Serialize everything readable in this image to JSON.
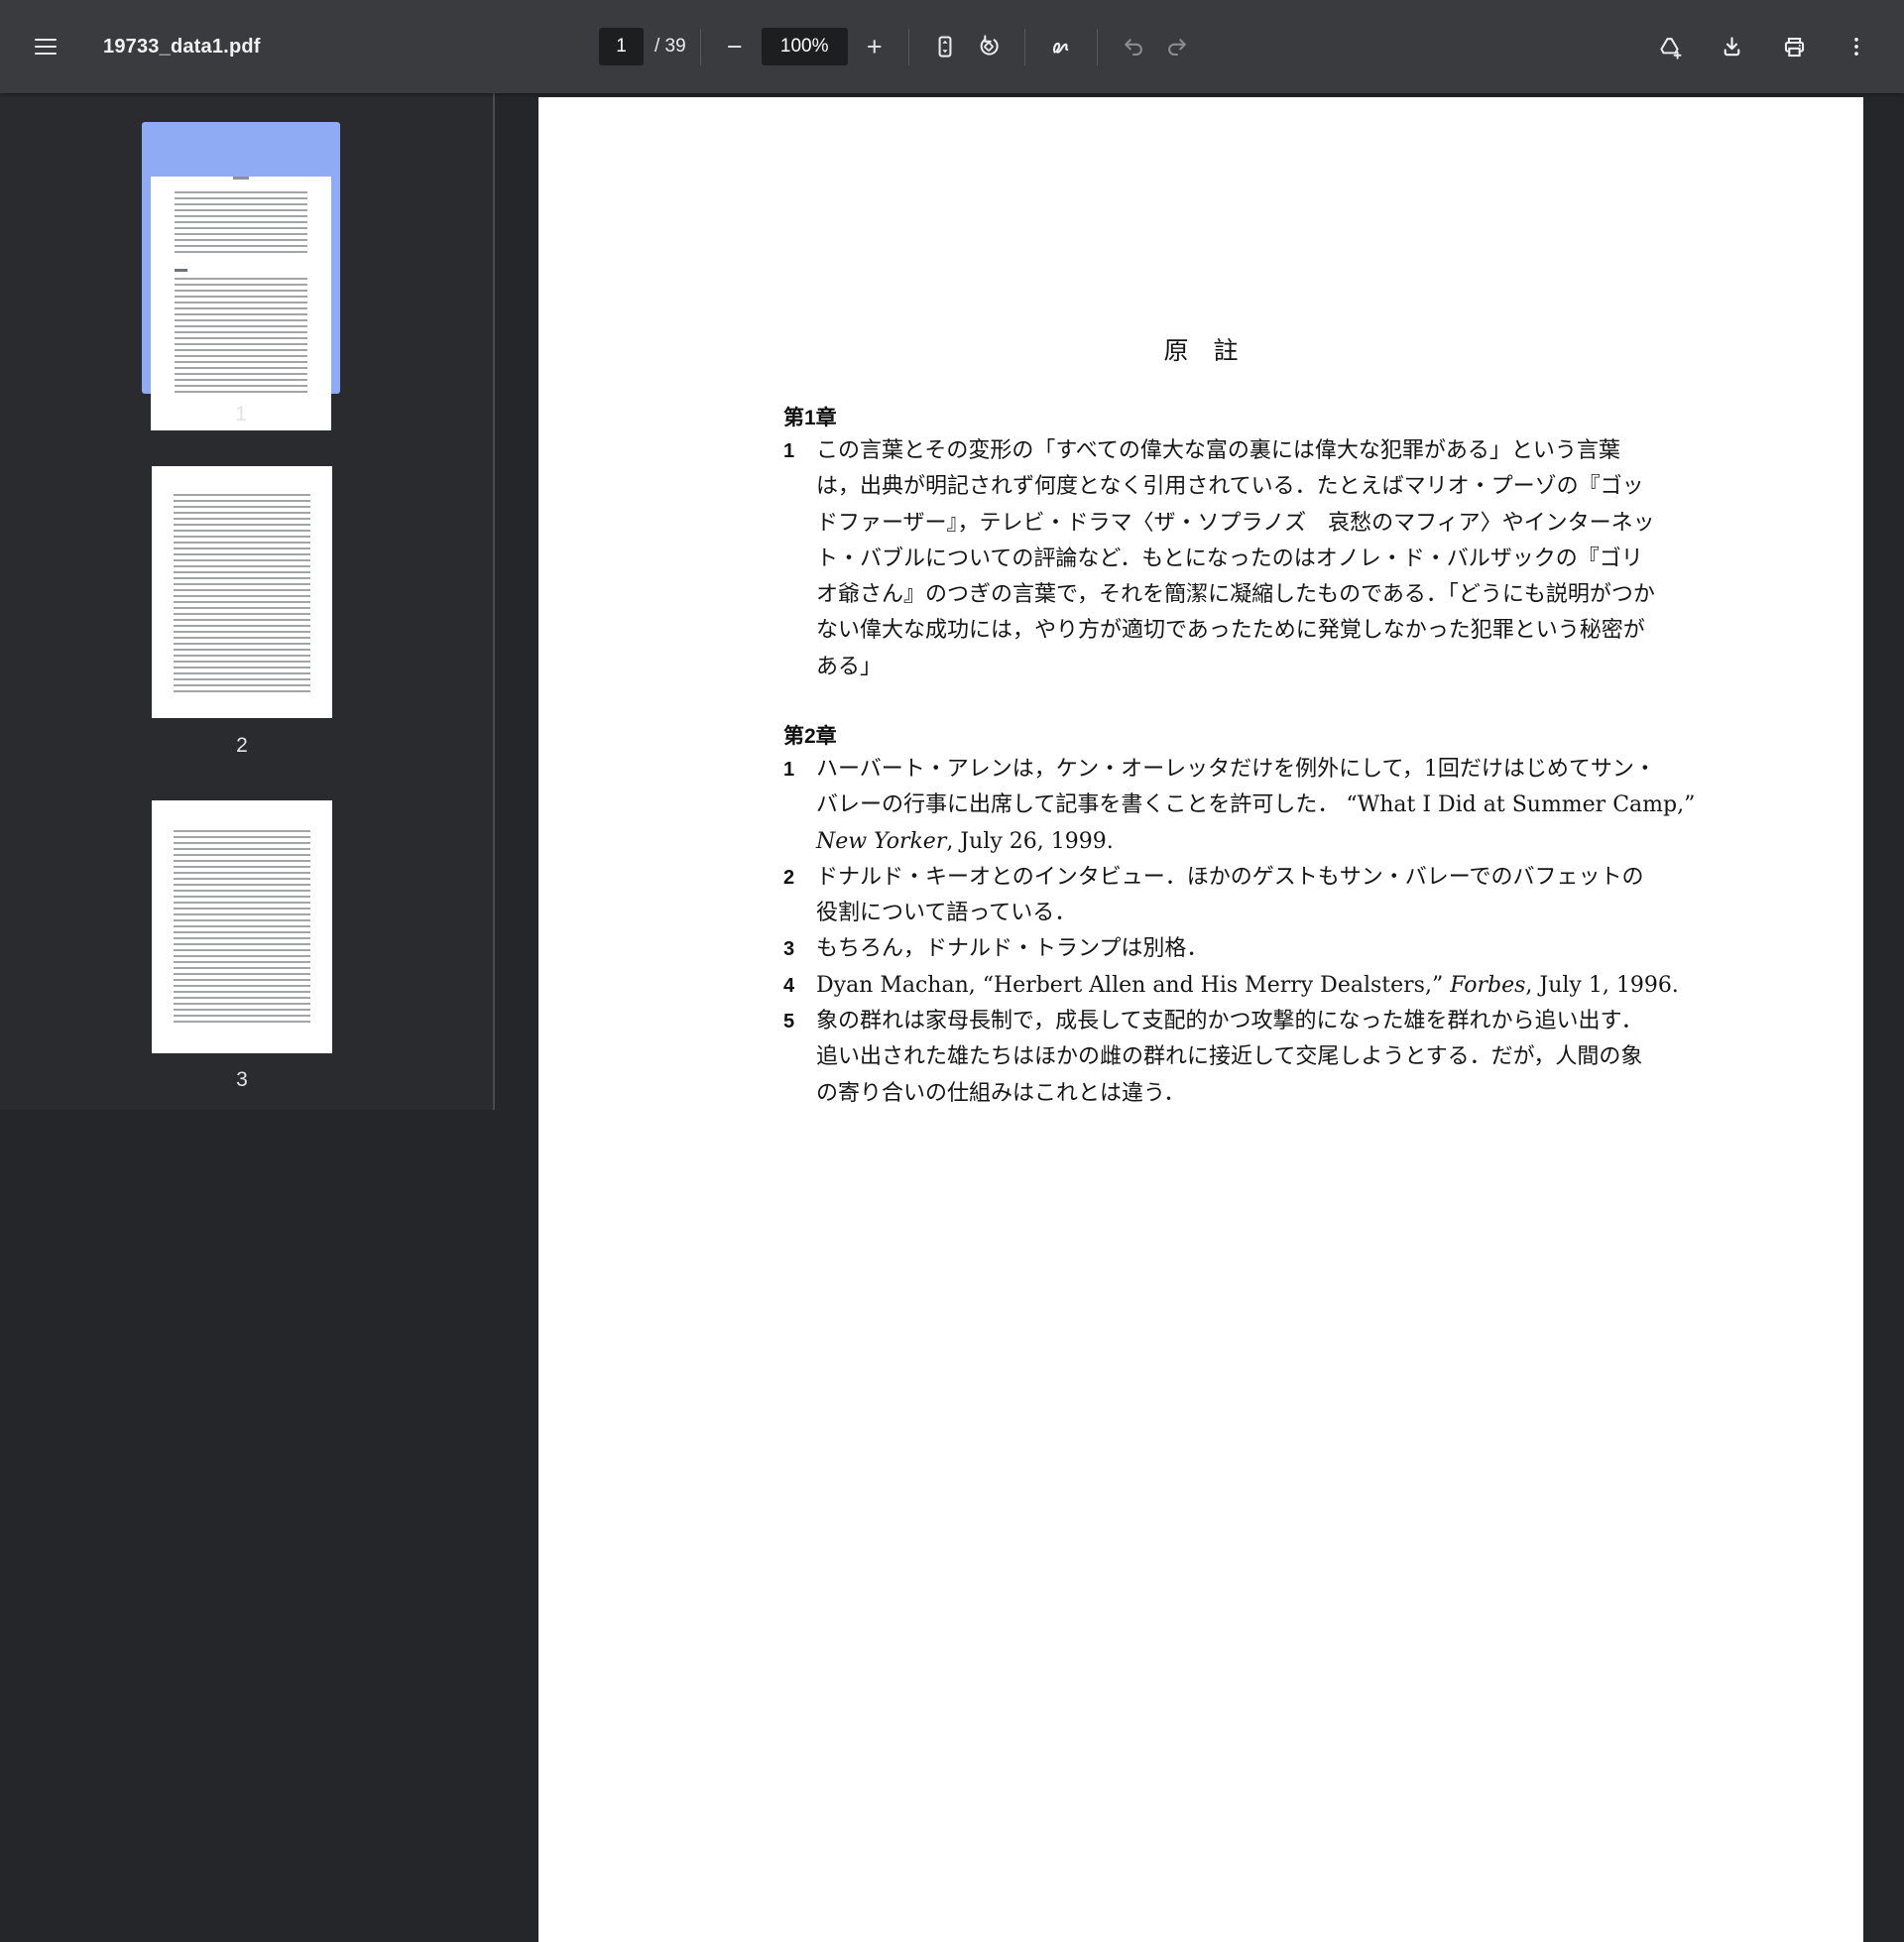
{
  "toolbar": {
    "filename": "19733_data1.pdf",
    "page_current": "1",
    "page_total": "/ 39",
    "zoom_out": "−",
    "zoom_level": "100%",
    "zoom_in": "+"
  },
  "icons": {
    "menu": "hamburger",
    "fit_page": "fit-to-page",
    "rotate": "rotate-counterclockwise",
    "annotate": "ink-pen-squiggle",
    "undo": "undo-arrow",
    "redo": "redo-arrow",
    "add_to_drive": "drive-add",
    "download": "download-arrow-tray",
    "print": "printer",
    "more": "vertical-three-dots"
  },
  "colors": {
    "toolbar_bg": "#3a3b3e",
    "sidebar_bg": "#2a2b2e",
    "viewer_bg": "#252629",
    "selected_thumbnail_border": "#8fabf3",
    "control_box_bg": "#1d1e20",
    "page_bg": "#ffffff"
  },
  "sidebar": {
    "thumbnails": [
      {
        "label": "1",
        "selected": true
      },
      {
        "label": "2",
        "selected": false
      },
      {
        "label": "3",
        "selected": false
      }
    ]
  },
  "doc": {
    "title": "原　註",
    "ch1": {
      "heading": "第1章",
      "n1": {
        "num": "1",
        "l1": "この言葉とその変形の「すべての偉大な富の裏には偉大な犯罪がある」という言葉",
        "l2": "は，出典が明記されず何度となく引用されている．たとえばマリオ・プーゾの『ゴッ",
        "l3": "ドファーザー』，テレビ・ドラマ〈ザ・ソプラノズ　哀愁のマフィア〉やインターネッ",
        "l4": "ト・バブルについての評論など．もとになったのはオノレ・ド・バルザックの『ゴリ",
        "l5": "オ爺さん』のつぎの言葉で，それを簡潔に凝縮したものである．「どうにも説明がつか",
        "l6": "ない偉大な成功には，やり方が適切であったために発覚しなかった犯罪という秘密が",
        "l7": "ある」"
      }
    },
    "ch2": {
      "heading": "第2章",
      "n1": {
        "num": "1",
        "l1": "ハーバート・アレンは，ケン・オーレッタだけを例外にして，1回だけはじめてサン・",
        "l2": "バレーの行事に出席して記事を書くことを許可した． “What I Did at Summer Camp,”",
        "l3_italic": "New Yorker",
        "l3_rest": ", July 26, 1999."
      },
      "n2": {
        "num": "2",
        "l1": "ドナルド・キーオとのインタビュー．ほかのゲストもサン・バレーでのバフェットの",
        "l2": "役割について語っている．"
      },
      "n3": {
        "num": "3",
        "l1": "もちろん，ドナルド・トランプは別格．"
      },
      "n4": {
        "num": "4",
        "pre": "Dyan Machan, “Herbert Allen and His Merry Dealsters,” ",
        "italic": "Forbes",
        "post": ", July 1, 1996."
      },
      "n5": {
        "num": "5",
        "l1": "象の群れは家母長制で，成長して支配的かつ攻撃的になった雄を群れから追い出す．",
        "l2": "追い出された雄たちはほかの雌の群れに接近して交尾しようとする．だが，人間の象",
        "l3": "の寄り合いの仕組みはこれとは違う．"
      }
    }
  }
}
